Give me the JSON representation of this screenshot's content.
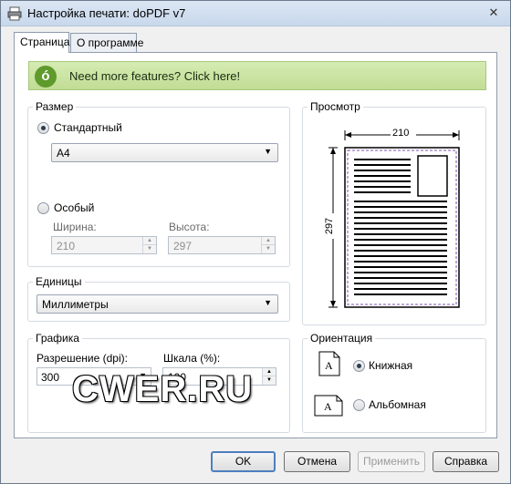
{
  "window": {
    "title": "Настройка печати: doPDF v7",
    "close_icon": "close-icon"
  },
  "tabs": [
    {
      "label": "Страница",
      "active": true
    },
    {
      "label": "О программе",
      "active": false
    }
  ],
  "banner": {
    "text": "Need more features? Click here!",
    "icon": "dopdf-logo-icon"
  },
  "size_group": {
    "label": "Размер",
    "standard_label": "Стандартный",
    "standard_checked": true,
    "standard_value": "A4",
    "custom_label": "Особый",
    "custom_checked": false,
    "width_label": "Ширина:",
    "width_value": "210",
    "height_label": "Высота:",
    "height_value": "297"
  },
  "preview_group": {
    "label": "Просмотр",
    "width_dim": "210",
    "height_dim": "297"
  },
  "units_group": {
    "label": "Единицы",
    "value": "Миллиметры"
  },
  "graphics_group": {
    "label": "Графика",
    "resolution_label": "Разрешение (dpi):",
    "resolution_value": "300",
    "scale_label": "Шкала (%):",
    "scale_value": "100"
  },
  "orientation_group": {
    "label": "Ориентация",
    "portrait_label": "Книжная",
    "portrait_checked": true,
    "landscape_label": "Альбомная",
    "landscape_checked": false
  },
  "watermark": "CWER.RU",
  "buttons": {
    "ok": "OK",
    "cancel": "Отмена",
    "apply": "Применить",
    "help": "Справка"
  },
  "colors": {
    "banner_green": "#c1dd94",
    "accent_blue": "#4d7fbf"
  }
}
